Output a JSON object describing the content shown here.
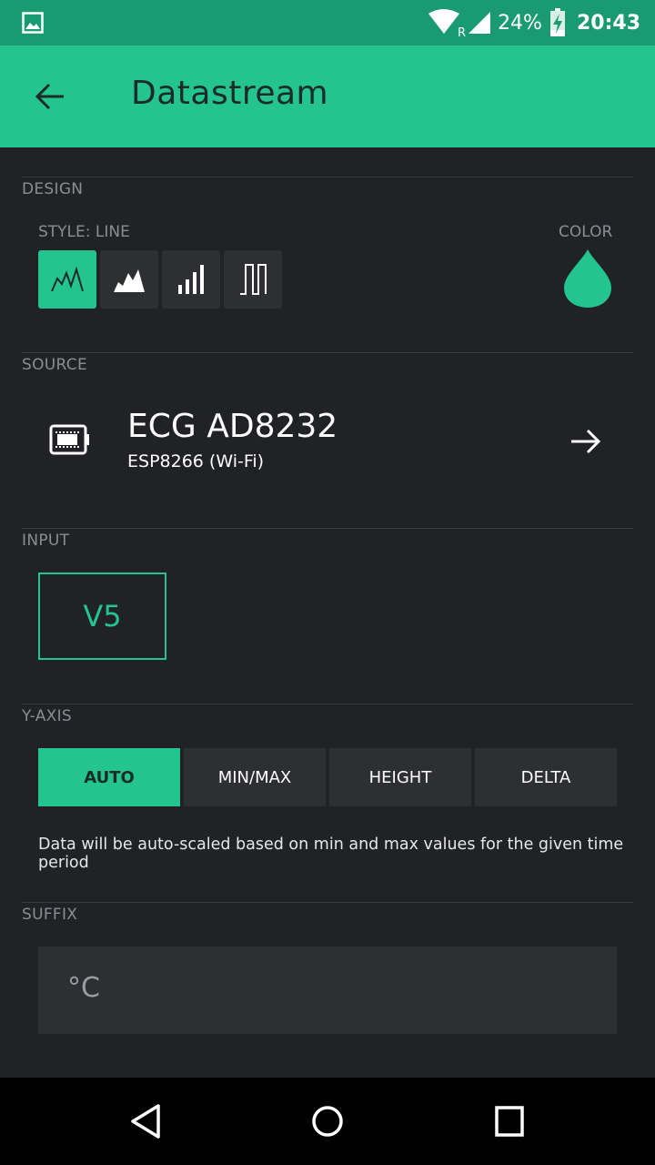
{
  "status_bar": {
    "battery_percent": "24%",
    "time": "20:43",
    "icons": [
      "gallery-icon",
      "wifi-icon",
      "signal-icon",
      "battery-charging-icon"
    ]
  },
  "app_bar": {
    "title": "Datastream",
    "back_icon": "arrow-left-icon"
  },
  "design": {
    "label": "DESIGN",
    "style_label": "STYLE: LINE",
    "color_label": "COLOR",
    "styles": [
      {
        "name": "line",
        "icon": "line-chart-icon",
        "active": true
      },
      {
        "name": "area",
        "icon": "area-chart-icon",
        "active": false
      },
      {
        "name": "bar",
        "icon": "bar-chart-icon",
        "active": false
      },
      {
        "name": "binary",
        "icon": "binary-chart-icon",
        "active": false
      }
    ],
    "color": "#23c48e"
  },
  "source": {
    "label": "SOURCE",
    "device_name": "ECG AD8232",
    "device_sub": "ESP8266 (Wi-Fi)"
  },
  "input": {
    "label": "INPUT",
    "pin": "V5"
  },
  "y_axis": {
    "label": "Y-AXIS",
    "options": [
      {
        "label": "AUTO",
        "active": true
      },
      {
        "label": "MIN/MAX",
        "active": false
      },
      {
        "label": "HEIGHT",
        "active": false
      },
      {
        "label": "DELTA",
        "active": false
      }
    ],
    "hint": "Data will be auto-scaled based on min and max values for the given time period"
  },
  "suffix": {
    "label": "SUFFIX",
    "value": "°C"
  },
  "colors": {
    "accent": "#23c48e",
    "background": "#212225",
    "status_bar": "#1a9a71"
  }
}
